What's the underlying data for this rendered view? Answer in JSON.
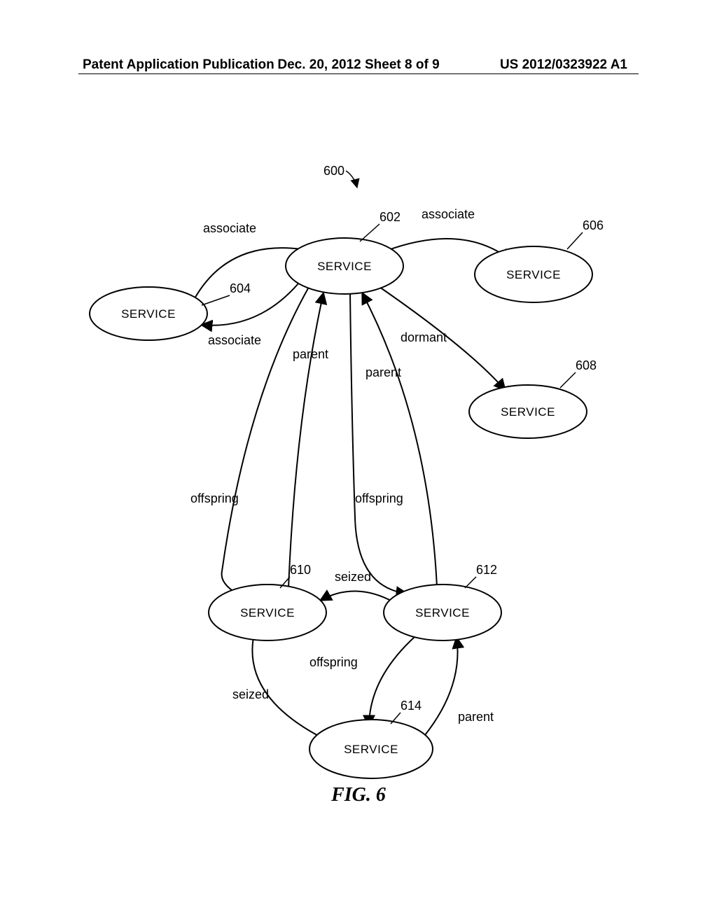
{
  "header": {
    "left": "Patent Application Publication",
    "mid": "Dec. 20, 2012  Sheet 8 of 9",
    "right": "US 2012/0323922 A1"
  },
  "caption": "FIG. 6",
  "refs": {
    "r600": "600",
    "r602": "602",
    "r604": "604",
    "r606": "606",
    "r608": "608",
    "r610": "610",
    "r612": "612",
    "r614": "614"
  },
  "nodes": {
    "n602": "SERVICE",
    "n604": "SERVICE",
    "n606": "SERVICE",
    "n608": "SERVICE",
    "n610": "SERVICE",
    "n612": "SERVICE",
    "n614": "SERVICE"
  },
  "edgeLabels": {
    "assoc_604_602": "associate",
    "assoc_602_604": "associate",
    "assoc_602_606": "associate",
    "dormant_602_608": "dormant",
    "parent_610_602": "parent",
    "parent_612_602": "parent",
    "offspring_602_610": "offspring",
    "offspring_602_612": "offspring",
    "seized_612_610": "seized",
    "offspring_612_614": "offspring",
    "seized_610_614": "seized",
    "parent_614_612": "parent"
  },
  "chart_data": {
    "type": "diagram",
    "figure_id": "600",
    "caption": "FIG. 6",
    "nodes": [
      {
        "id": "602",
        "label": "SERVICE"
      },
      {
        "id": "604",
        "label": "SERVICE"
      },
      {
        "id": "606",
        "label": "SERVICE"
      },
      {
        "id": "608",
        "label": "SERVICE"
      },
      {
        "id": "610",
        "label": "SERVICE"
      },
      {
        "id": "612",
        "label": "SERVICE"
      },
      {
        "id": "614",
        "label": "SERVICE"
      }
    ],
    "edges": [
      {
        "from": "604",
        "to": "602",
        "label": "associate"
      },
      {
        "from": "602",
        "to": "604",
        "label": "associate"
      },
      {
        "from": "602",
        "to": "606",
        "label": "associate"
      },
      {
        "from": "602",
        "to": "608",
        "label": "dormant"
      },
      {
        "from": "610",
        "to": "602",
        "label": "parent"
      },
      {
        "from": "612",
        "to": "602",
        "label": "parent"
      },
      {
        "from": "602",
        "to": "610",
        "label": "offspring"
      },
      {
        "from": "602",
        "to": "612",
        "label": "offspring"
      },
      {
        "from": "612",
        "to": "610",
        "label": "seized"
      },
      {
        "from": "612",
        "to": "614",
        "label": "offspring"
      },
      {
        "from": "610",
        "to": "614",
        "label": "seized"
      },
      {
        "from": "614",
        "to": "612",
        "label": "parent"
      }
    ]
  }
}
